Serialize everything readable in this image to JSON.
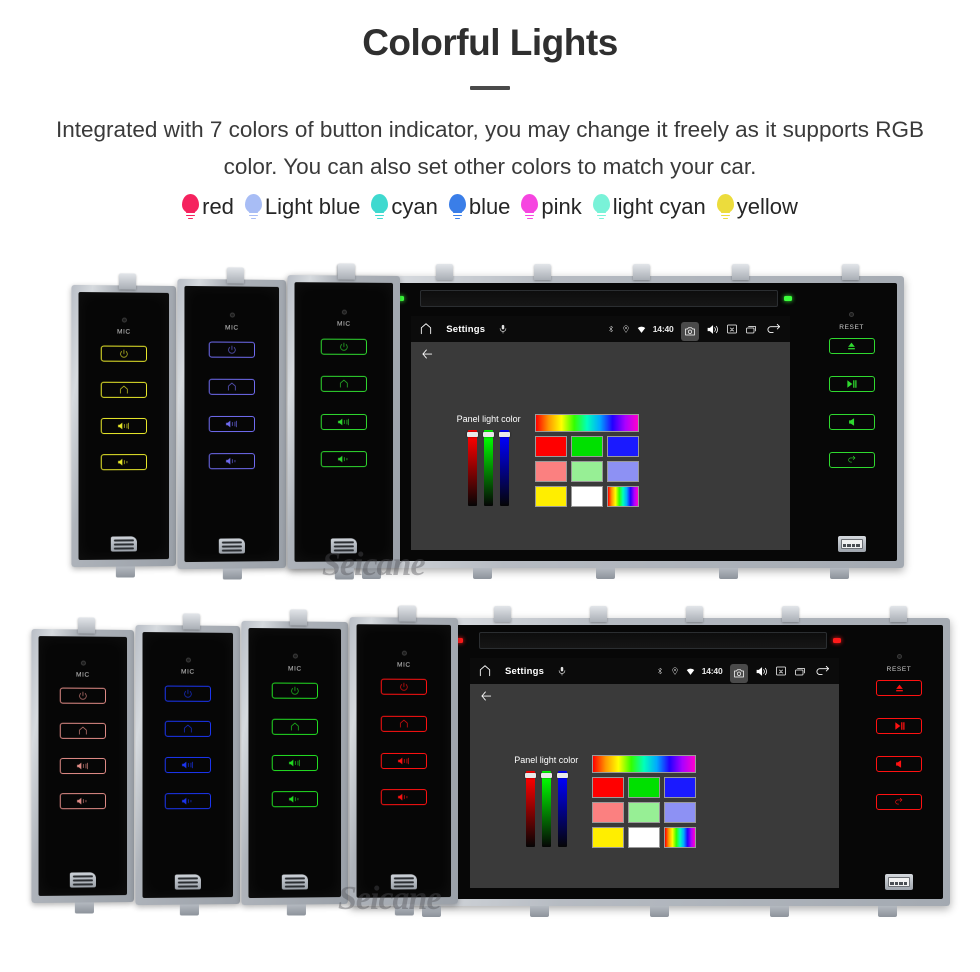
{
  "header": {
    "title": "Colorful Lights",
    "subtitle": "Integrated with 7 colors of button indicator, you may change it freely as it supports RGB color. You can also set other colors to match your car."
  },
  "legend": [
    {
      "label": "red",
      "color": "#f5225e"
    },
    {
      "label": "Light blue",
      "color": "#a8bdf5"
    },
    {
      "label": "cyan",
      "color": "#3fd9cf"
    },
    {
      "label": "blue",
      "color": "#3a7ee8"
    },
    {
      "label": "pink",
      "color": "#f645e0"
    },
    {
      "label": "light cyan",
      "color": "#79f2d8"
    },
    {
      "label": "yellow",
      "color": "#ecdc3c"
    }
  ],
  "watermark": "Seicane",
  "device": {
    "mic_label": "MIC",
    "reset_label": "RESET",
    "left_buttons": [
      "power-icon",
      "home-icon",
      "volume-up-icon",
      "volume-down-icon"
    ],
    "right_buttons": [
      "eject-icon",
      "play-pause-icon",
      "mute-icon",
      "back-icon"
    ],
    "screen": {
      "statusbar": {
        "home_icon": "home-icon",
        "title": "Settings",
        "mic_icon": "microphone-icon",
        "bluetooth_icon": "bluetooth-icon",
        "location_icon": "location-icon",
        "wifi_icon": "wifi-icon",
        "clock": "14:40",
        "camera_icon": "camera-icon",
        "volume_icon": "volume-icon",
        "close_icon": "close-box-icon",
        "recents_icon": "recents-icon",
        "back_icon": "back-arrow-icon"
      },
      "actionbar": {
        "back_icon": "back-arrow-icon"
      },
      "panel": {
        "label": "Panel light color",
        "sliders": [
          {
            "name": "red-slider",
            "color": "#ff0000",
            "value": 96
          },
          {
            "name": "green-slider",
            "color": "#00ff00",
            "value": 96
          },
          {
            "name": "blue-slider",
            "color": "#0000ff",
            "value": 96
          }
        ],
        "swatch_spectrum": "rainbow-gradient",
        "swatches": [
          [
            "#ff0000",
            "#00e000",
            "#1a1aff"
          ],
          [
            "#fb8080",
            "#97ef95",
            "#8d91f4"
          ],
          [
            "#ffee00",
            "#ffffff",
            "rainbow-gradient"
          ]
        ]
      }
    }
  },
  "rows": [
    {
      "name": "row-green",
      "led_color": "#3cff3c",
      "panels": [
        {
          "name": "panel-yellow",
          "color": "#e8e82a"
        },
        {
          "name": "panel-light-blue",
          "color": "#6f6bf0"
        },
        {
          "name": "panel-green",
          "color": "#2fd92f"
        }
      ],
      "main_color": "#2fd92f"
    },
    {
      "name": "row-red",
      "led_color": "#ff1a1a",
      "panels": [
        {
          "name": "panel-salmon",
          "color": "#e08b86"
        },
        {
          "name": "panel-blue",
          "color": "#1b35f0"
        },
        {
          "name": "panel-green",
          "color": "#22dd22"
        },
        {
          "name": "panel-red",
          "color": "#ff1111"
        }
      ],
      "main_color": "#ff1111"
    }
  ]
}
